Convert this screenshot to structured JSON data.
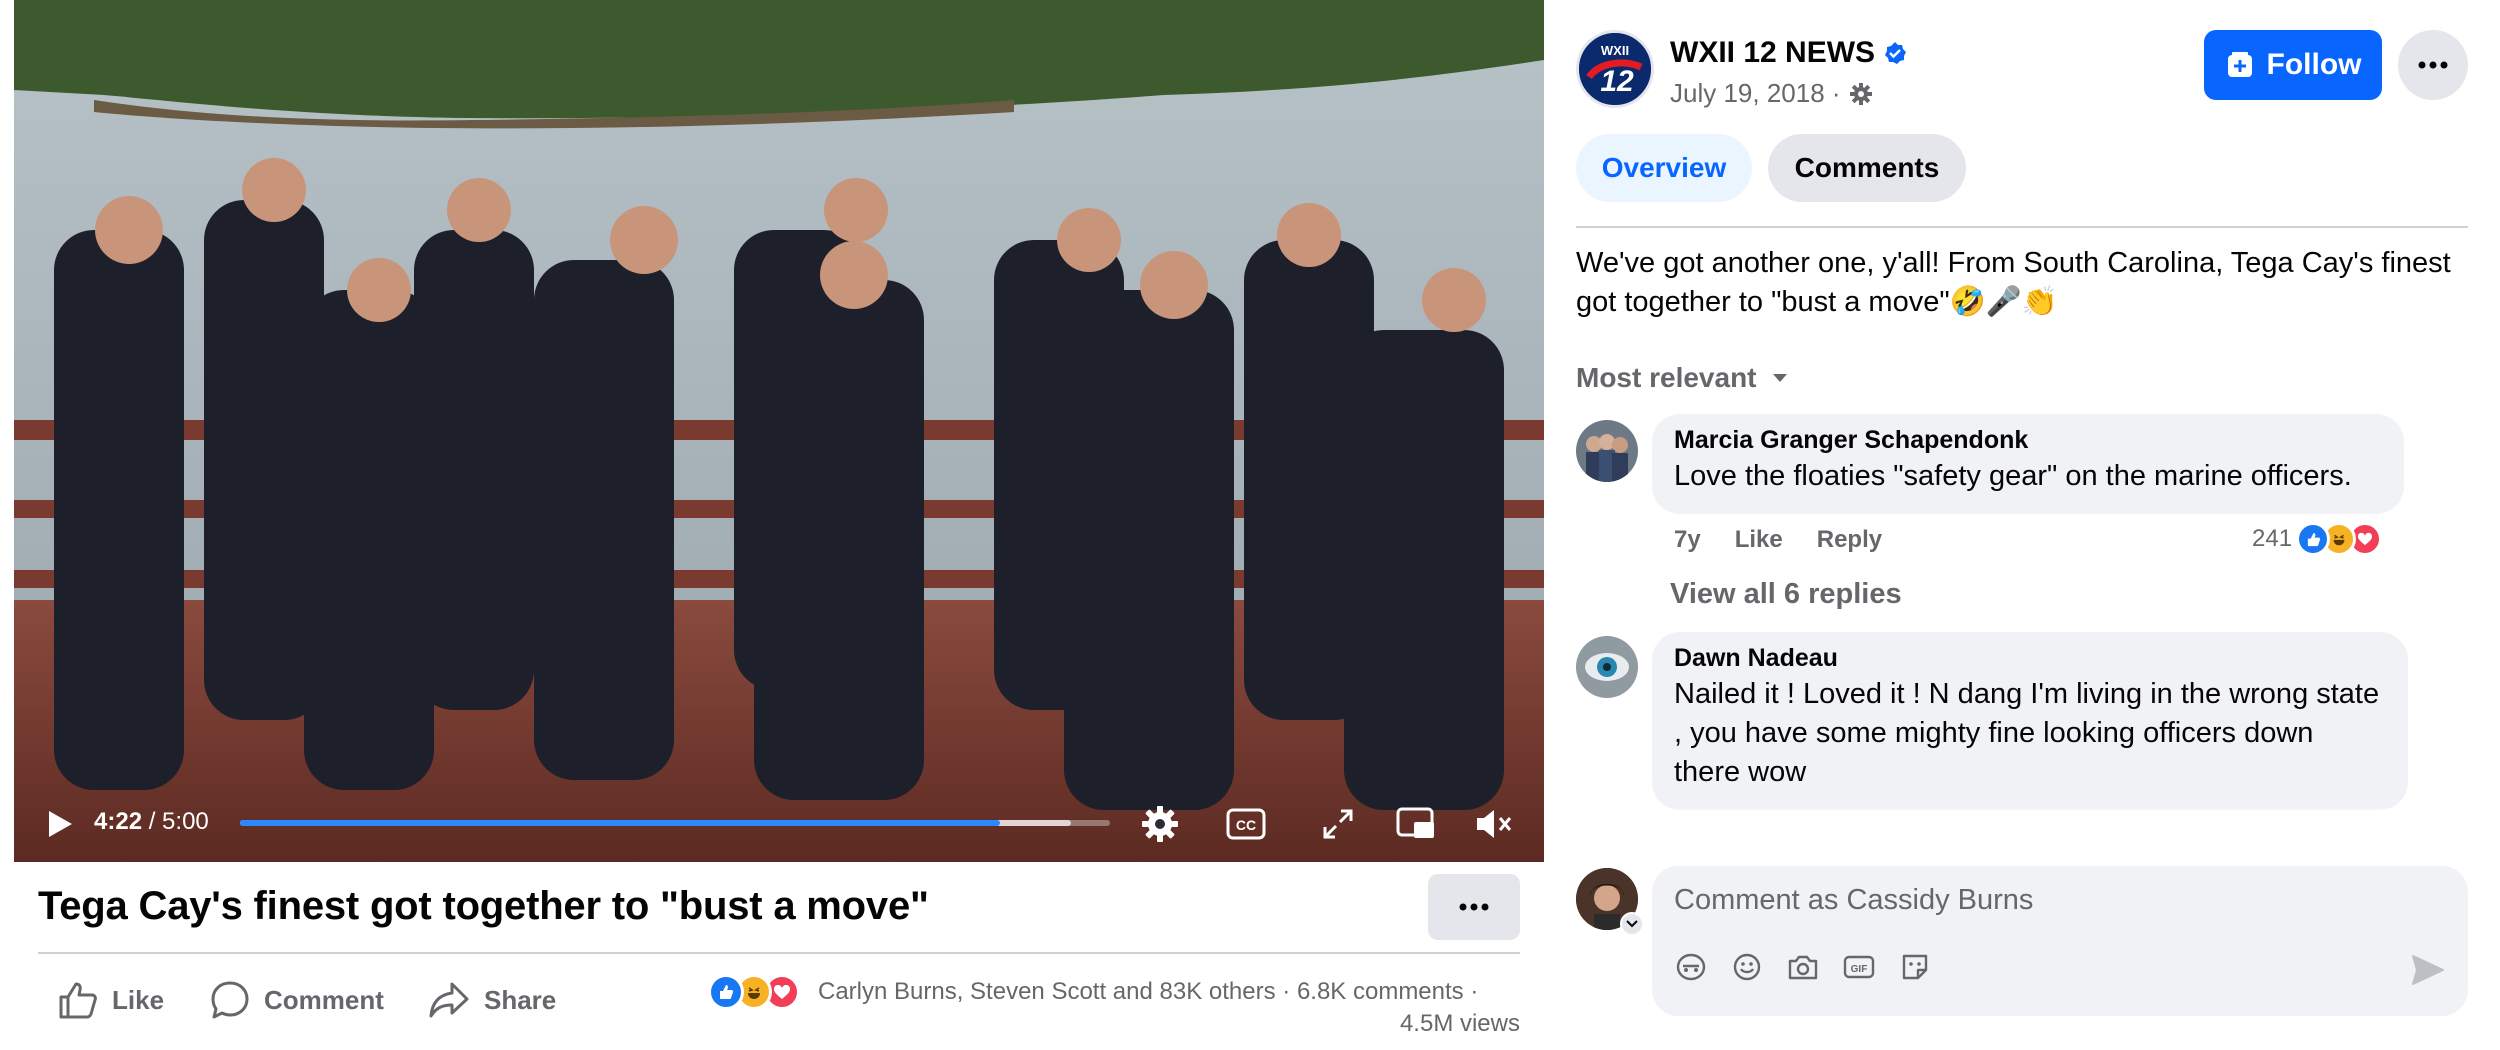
{
  "video": {
    "current_time": "4:22",
    "duration": "/ 5:00",
    "progress": 0.873,
    "buffered": 0.955
  },
  "post": {
    "title": "Tega Cay's finest got together to \"bust a move\"",
    "like_label": "Like",
    "comment_label": "Comment",
    "share_label": "Share",
    "reactions_text": "Carlyn Burns, Steven Scott and 83K others",
    "comments_count": "6.8K comments",
    "separator": "·",
    "views": "4.5M views"
  },
  "page": {
    "name": "WXII 12 NEWS",
    "date": "July 19, 2018 ·",
    "logo_text": "WXII",
    "logo_number": "12",
    "follow_label": "Follow"
  },
  "tabs": {
    "overview": "Overview",
    "comments": "Comments"
  },
  "description": "We've got another one, y'all! From South Carolina, Tega Cay's finest got together to \"bust a move\"🤣🎤👏",
  "sort_label": "Most relevant",
  "comments": [
    {
      "author": "Marcia Granger Schapendonk",
      "text": "Love the floaties \"safety gear\" on the marine officers.",
      "age": "7y",
      "like": "Like",
      "reply": "Reply",
      "reaction_count": "241"
    },
    {
      "author": "Dawn Nadeau",
      "text": "Nailed it ! Loved it ! N dang I'm living in the wrong state , you have some mighty fine looking officers down there wow"
    }
  ],
  "view_replies": "View all 6 replies",
  "composer": {
    "placeholder": "Comment as Cassidy Burns"
  },
  "colors": {
    "accent": "#0866ff",
    "like_blue": "#1877f2",
    "love_red": "#f33e58",
    "haha_yellow": "#f7b125"
  }
}
